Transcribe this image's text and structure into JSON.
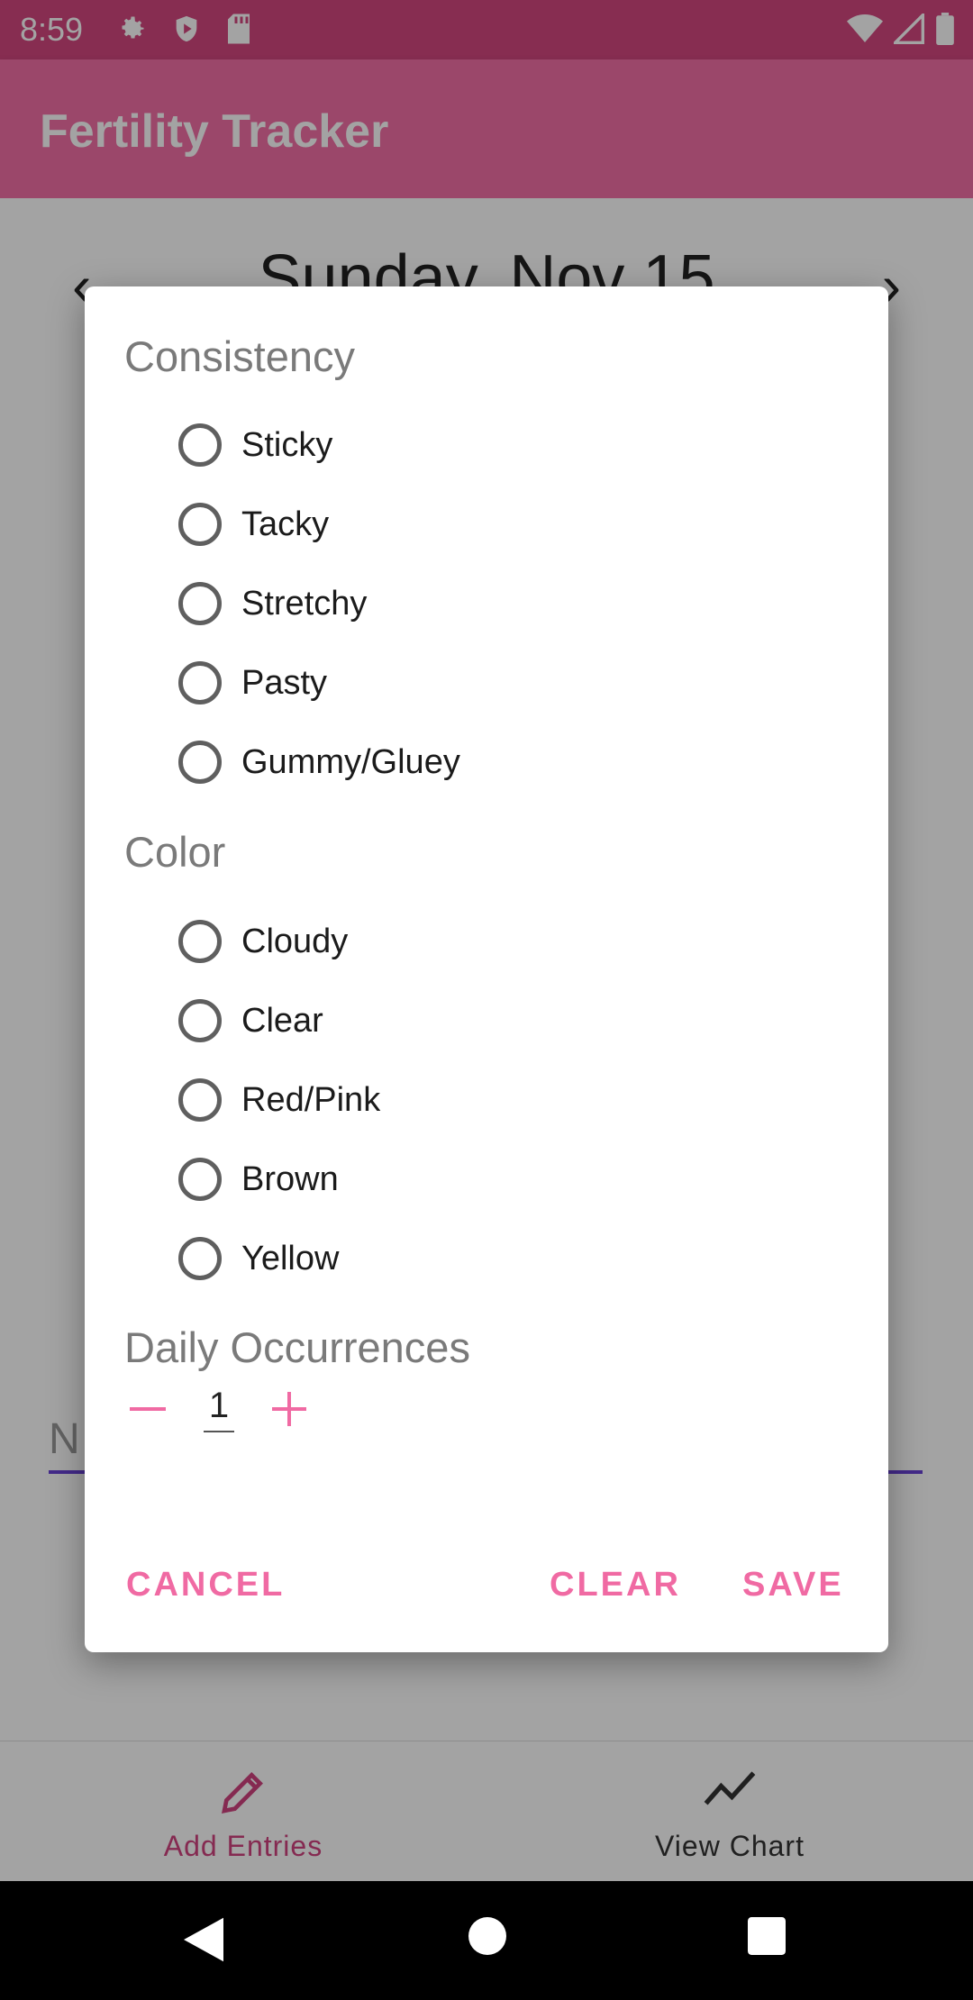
{
  "status_bar": {
    "time": "8:59",
    "left_icons": [
      "gear-icon",
      "shield-icon",
      "sd-card-icon"
    ],
    "right_icons": [
      "wifi-icon",
      "signal-icon",
      "battery-icon"
    ]
  },
  "app_bar": {
    "title": "Fertility Tracker",
    "color": "#f26fa6"
  },
  "content": {
    "date_title": "Sunday, Nov 15",
    "notes_placeholder": "N"
  },
  "dialog": {
    "consistency": {
      "title": "Consistency",
      "options": [
        "Sticky",
        "Tacky",
        "Stretchy",
        "Pasty",
        "Gummy/Gluey"
      ]
    },
    "color": {
      "title": "Color",
      "options": [
        "Cloudy",
        "Clear",
        "Red/Pink",
        "Brown",
        "Yellow"
      ]
    },
    "occurrences": {
      "title": "Daily Occurrences",
      "value": "1"
    },
    "buttons": {
      "cancel": "CANCEL",
      "clear": "CLEAR",
      "save": "SAVE"
    },
    "accent_color": "#f06aa3"
  },
  "bottom_nav": {
    "items": [
      {
        "label": "Add Entries",
        "icon": "pencil-icon",
        "active": true
      },
      {
        "label": "View Chart",
        "icon": "trend-line-icon",
        "active": false
      }
    ]
  },
  "system_nav": [
    "back-icon",
    "home-icon",
    "recents-icon"
  ]
}
